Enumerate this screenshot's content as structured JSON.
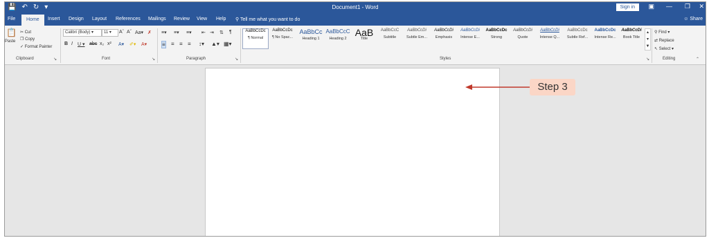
{
  "window": {
    "doc_title": "Document1 - Word",
    "sign_in": "Sign in",
    "share": "Share"
  },
  "tabs": [
    "File",
    "Home",
    "Insert",
    "Design",
    "Layout",
    "References",
    "Mailings",
    "Review",
    "View",
    "Help"
  ],
  "tell_me": "Tell me what you want to do",
  "clipboard": {
    "paste": "Paste",
    "cut": "Cut",
    "copy": "Copy",
    "format_painter": "Format Painter",
    "label": "Clipboard"
  },
  "font": {
    "name": "Calibri (Body)",
    "size": "11",
    "label": "Font"
  },
  "paragraph": {
    "label": "Paragraph"
  },
  "styles": {
    "label": "Styles",
    "items": [
      {
        "sample": "AaBbCcDc",
        "name": "¶ Normal"
      },
      {
        "sample": "AaBbCcDc",
        "name": "¶ No Spac..."
      },
      {
        "sample": "AaBbCc",
        "name": "Heading 1"
      },
      {
        "sample": "AaBbCcC",
        "name": "Heading 2"
      },
      {
        "sample": "AaB",
        "name": "Title"
      },
      {
        "sample": "AaBbCcC",
        "name": "Subtitle"
      },
      {
        "sample": "AaBbCcDi",
        "name": "Subtle Em..."
      },
      {
        "sample": "AaBbCcDi",
        "name": "Emphasis"
      },
      {
        "sample": "AaBbCcDi",
        "name": "Intense E..."
      },
      {
        "sample": "AaBbCcDc",
        "name": "Strong"
      },
      {
        "sample": "AaBbCcDi",
        "name": "Quote"
      },
      {
        "sample": "AaBbCcDi",
        "name": "Intense Q..."
      },
      {
        "sample": "AaBbCcDc",
        "name": "Subtle Ref..."
      },
      {
        "sample": "AaBbCcDc",
        "name": "Intense Re..."
      },
      {
        "sample": "AaBbCcDi",
        "name": "Book Title"
      }
    ]
  },
  "editing": {
    "find": "Find",
    "replace": "Replace",
    "select": "Select",
    "label": "Editing"
  },
  "annotation": {
    "step": "Step 3"
  },
  "colors": {
    "accent": "#2b579a",
    "callout": "#fbd6c6",
    "arrow": "#c0392b"
  }
}
